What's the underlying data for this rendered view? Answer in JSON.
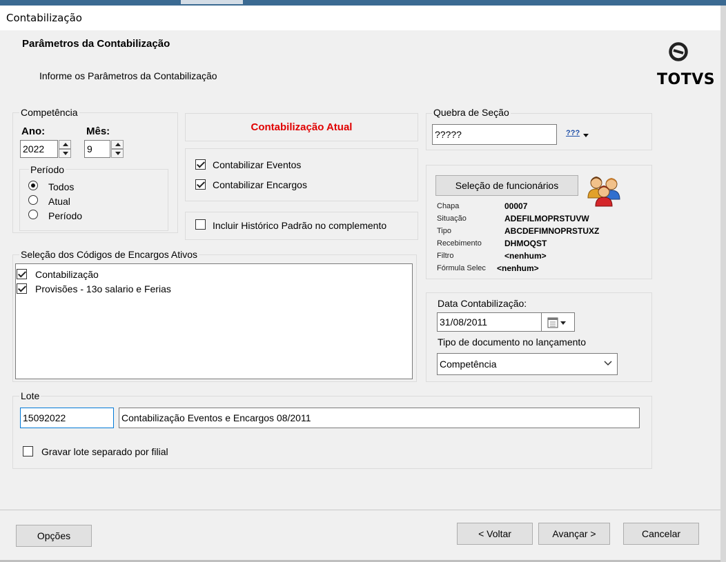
{
  "window": {
    "title": "Contabilização"
  },
  "header": {
    "title": "Parâmetros da Contabilização",
    "subtitle": "Informe os Parâmetros da Contabilização",
    "logo_text": "TOTVS"
  },
  "competencia": {
    "legend": "Competência",
    "ano_label": "Ano:",
    "ano_value": "2022",
    "mes_label": "Mês:",
    "mes_value": "9",
    "periodo": {
      "legend": "Período",
      "options": [
        "Todos",
        "Atual",
        "Período"
      ],
      "selected": "Todos"
    }
  },
  "contabilizacao_atual": {
    "label": "Contabilização Atual",
    "color": "#e00000"
  },
  "checks": {
    "eventos": {
      "label": "Contabilizar Eventos",
      "checked": true
    },
    "encargos": {
      "label": "Contabilizar Encargos",
      "checked": true
    },
    "historico": {
      "label": "Incluir Histórico Padrão no complemento",
      "checked": false
    }
  },
  "quebra_secao": {
    "legend": "Quebra de Seção",
    "value": "?????",
    "button_label": "???"
  },
  "selecao_funcionarios": {
    "button_label": "Seleção de funcionários",
    "icon": "users-group-icon",
    "fields": [
      {
        "label": "Chapa",
        "value": "00007"
      },
      {
        "label": "Situação",
        "value": "ADEFILMOPRSTUVW"
      },
      {
        "label": "Tipo",
        "value": "ABCDEFIMNOPRSTUXZ"
      },
      {
        "label": "Recebimento",
        "value": "DHMOQST"
      },
      {
        "label": "Filtro",
        "value": "<nenhum>"
      },
      {
        "label": "Fórmula Selec",
        "value": "<nenhum>"
      }
    ]
  },
  "encargos": {
    "legend": "Seleção dos Códigos de Encargos Ativos",
    "items": [
      {
        "label": "Contabilização",
        "checked": true
      },
      {
        "label": "Provisões - 13o salario e Ferias",
        "checked": true
      }
    ]
  },
  "data_contab": {
    "label": "Data Contabilização:",
    "value": "31/08/2011",
    "tipo_doc_label": "Tipo de documento no lançamento",
    "tipo_doc_value": "Competência"
  },
  "lote": {
    "legend": "Lote",
    "code": "15092022",
    "description": "Contabilização Eventos e Encargos 08/2011",
    "gravar_label": "Gravar lote separado por filial",
    "gravar_checked": false
  },
  "footer": {
    "opcoes": "Opções",
    "voltar": "< Voltar",
    "avancar": "Avançar >",
    "cancelar": "Cancelar"
  }
}
